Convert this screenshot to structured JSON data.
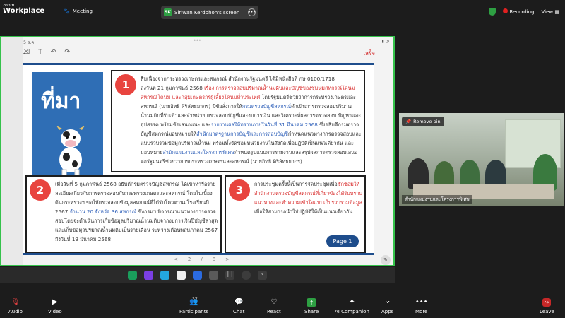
{
  "app": {
    "logo_line1": "zoom",
    "logo_line2": "Workplace",
    "meeting_label": "Meeting",
    "screen_owner_initials": "SK",
    "screen_owner_label": "Siriwan Kerdphon's screen",
    "recording_label": "Recording",
    "view_label": "View"
  },
  "tablet": {
    "status": "09:02 น. 5 ส.ค.",
    "done_label": "เสร็จ",
    "pager": {
      "prev": "<",
      "current": "2",
      "sep": "/",
      "total": "8",
      "next": ">"
    }
  },
  "slide": {
    "heading": "ที่มา",
    "box1": {
      "number": "1",
      "line1": "สืบเนื่องจากกระทรวงเกษตรและสหกรณ์ สำนักงานรัฐมนตรี ได้มีหนังสือที่ กษ 0100/1718",
      "p_a": "ลงวันที่ 21 กุมภาพันธ์ 2568 ",
      "p_red1": "เรื่อง การตรวจสอบปริมาณน้ำนมดิบและบัญชีของชุมนุมสหกรณ์โคนม สหกรณ์โคนม และกลุ่มเกษตรกรผู้เลี้ยงโคนมทั่วประเทศ",
      "p_b": " โดยรัฐมนตรีช่วยว่าการกระทรวงเกษตรและสหกรณ์ (นายอิทธิ ศิริลัทธยากร) มีข้อสั่งการให้",
      "p_blue1": "กรมตรวจบัญชีสหกรณ์",
      "p_c": "ดำเนินการตรวจสอบปริมาณน้ำนมดิบที่รับเข้าและจำหน่าย ตรวจสอบบัญชีและงบการเงิน และวิเคราะห์ผลการตรวจสอบ ปัญหาและอุปสรรค พร้อมข้อเสนอแนะ และ",
      "p_blue2": "รายงานผลให้ทราบภายในวันที่ 31 มีนาคม 2568",
      "p_d": " ซึ่งอธิบดีกรมตรวจบัญชีสหกรณ์มอบหมายให้",
      "p_blue3": "สำนักมาตรฐานการบัญชีและการสอบบัญชี",
      "p_e": "กำหนดแนวทางการตรวจสอบและแบบรวบรวมข้อมูลปริมาณน้ำนม พร้อมทั้งจัดซ้อมหน่วยงานในสังกัดเพื่อปฏิบัติเป็นแนวเดียวกัน และมอบหมาย",
      "p_blue4": "สำนักแผนงานและโครงการพิเศษ",
      "p_f": "กำหนดรูปแบบการรายงานและสรุปผลการตรวจสอบเสนอต่อรัฐมนตรีช่วยว่าการกระทรวงเกษตรและสหกรณ์ (นายอิทธิ ศิริลัทธยากร)"
    },
    "box2": {
      "number": "2",
      "p_a": "เมื่อวันที่ 5 กุมภาพันธ์ 2568 อธิบดีกรมตรวจบัญชีสหกรณ์ ได้เข้าหารือรายละเอียดเกี่ยวกับการตรวจสอบกับกระทรวงเกษตรและสหกรณ์ โดยในเบื้องต้นกระทรวงฯ ขอให้ตรวจสอบข้อมูลสหกรณ์ที่ได้รับโควตานมโรงเรียนปี 2567 ",
      "p_blue": "จำนวน 20 จังหวัด 36 สหกรณ์",
      "p_b": " ซึ่งกรมฯ พิจารณาแนวทางการตรวจสอบโดยจะดำเนินการเก็บข้อมูลปริมาณน้ำนมดิบจากงบการเงินปีบัญชีล่าสุด และเก็บข้อมูลปริมาณน้ำนมดิบเป็นรายเดือน ระหว่างเดือนพฤษภาคม 2567 ถึงวันที่ 19 มีนาคม 2568"
    },
    "box3": {
      "number": "3",
      "p_a": "การประชุมครั้งนี้เป็นการจัดประชุมเพื่อ",
      "p_red": "ซักซ้อมให้สำนักงานตรวจบัญชีสหกรณ์ที่เกี่ยวข้องได้รับทราบแนวทางและทำความเข้าใจแบบเก็บรวบรวมข้อมูล",
      "p_b": " เพื่อให้สามารถนำไปปฏิบัติให้เป็นแนวเดียวกัน",
      "page_label": "Page 1"
    }
  },
  "video": {
    "remove_pin_label": "Remove pin",
    "participant_name": "สำนักแผนงานและโครงการพิเศษ"
  },
  "bottombar": {
    "audio": "Audio",
    "video": "Video",
    "participants": "Participants",
    "participants_count": "37",
    "chat": "Chat",
    "react": "React",
    "share": "Share",
    "ai": "AI Companion",
    "apps": "Apps",
    "more": "More",
    "leave": "Leave"
  },
  "colors": {
    "share_border": "#35c24b",
    "slide_blue": "#2f6eb5",
    "number_red": "#e8443f",
    "recording_red": "#e02020"
  }
}
